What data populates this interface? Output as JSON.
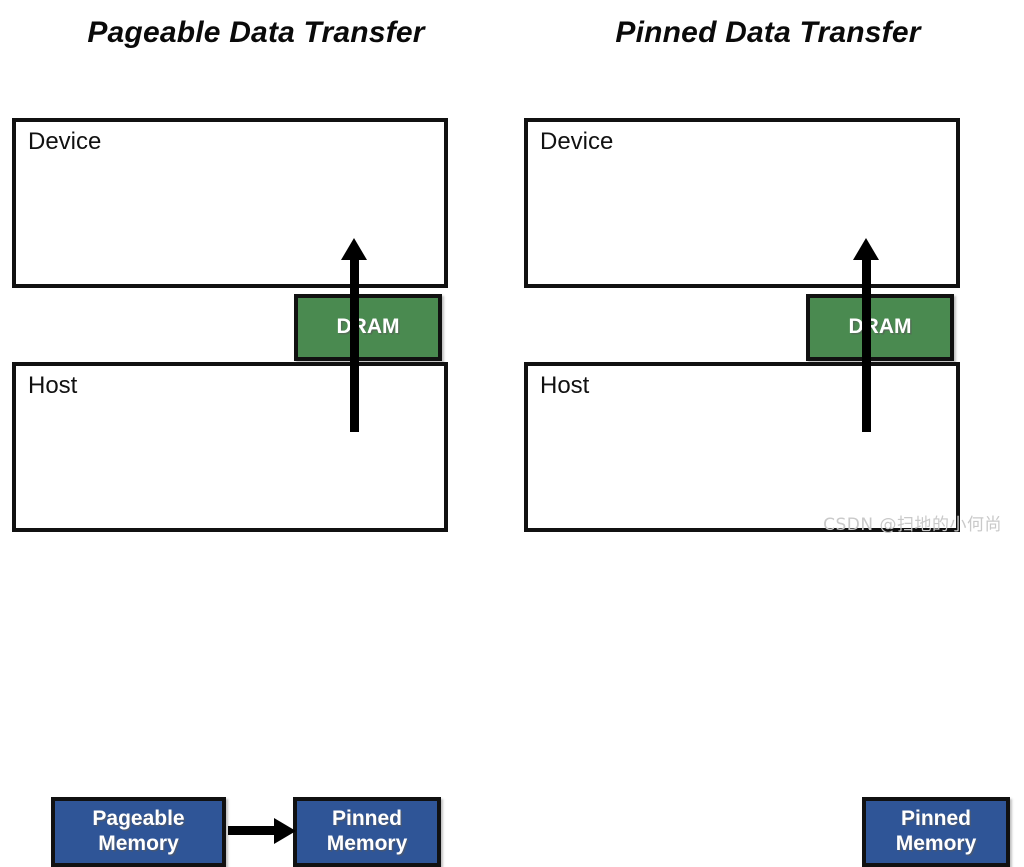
{
  "panels": [
    {
      "id": "pageable",
      "title": "Pageable Data Transfer",
      "device": {
        "label": "Device",
        "blocks": [
          {
            "name": "dram",
            "label": "DRAM",
            "color": "#4a8a50"
          }
        ]
      },
      "host": {
        "label": "Host",
        "blocks": [
          {
            "name": "pageable-memory",
            "label": "Pageable\nMemory",
            "color": "#2f5597"
          },
          {
            "name": "pinned-memory",
            "label": "Pinned\nMemory",
            "color": "#2f5597"
          }
        ]
      },
      "arrows": [
        {
          "name": "pageable-to-pinned-arrow",
          "direction": "right"
        },
        {
          "name": "pinned-to-dram-arrow",
          "direction": "up"
        }
      ]
    },
    {
      "id": "pinned",
      "title": "Pinned Data Transfer",
      "device": {
        "label": "Device",
        "blocks": [
          {
            "name": "dram",
            "label": "DRAM",
            "color": "#4a8a50"
          }
        ]
      },
      "host": {
        "label": "Host",
        "blocks": [
          {
            "name": "pinned-memory",
            "label": "Pinned\nMemory",
            "color": "#2f5597"
          }
        ]
      },
      "arrows": [
        {
          "name": "pinned-to-dram-arrow",
          "direction": "up"
        }
      ]
    }
  ],
  "watermark": "CSDN @扫地的小何尚",
  "colors": {
    "dram_green": "#4a8a50",
    "memory_blue": "#2f5597",
    "outline_black": "#111111",
    "background": "#ffffff",
    "watermark_gray": "#c9c9c9"
  }
}
